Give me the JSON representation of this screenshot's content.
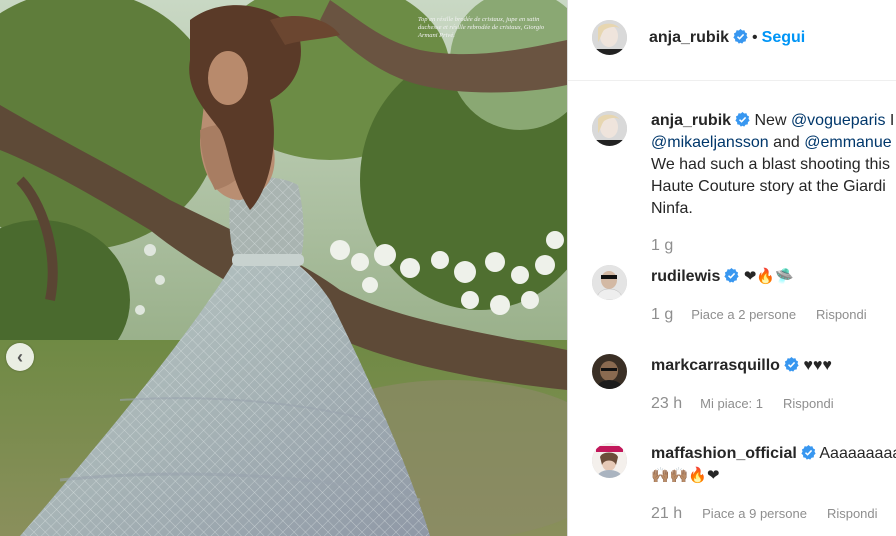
{
  "photo": {
    "caption": "Top en résille brodée de cristaux, jupe en satin duchesse et résille rebrodée de cristaux, Giorgio Armani Privé.",
    "nav_prev_glyph": "‹"
  },
  "header": {
    "username": "anja_rubik",
    "separator": "•",
    "follow_label": "Segui"
  },
  "post_caption": {
    "username": "anja_rubik",
    "line1_pre": "New ",
    "line1_mention": "@vogueparis",
    "line1_post": " I",
    "line2_mention_a": "@mikaeljansson",
    "line2_mid": " and ",
    "line2_mention_b": "@emmanue",
    "line3": "We had such a blast shooting this",
    "line4": "Haute Couture story at the Giardi",
    "line5": "Ninfa.",
    "time": "1 g"
  },
  "comments": [
    {
      "username": "rudilewis",
      "text": "❤🔥🛸",
      "time": "1 g",
      "likes": "Piace a 2 persone",
      "reply": "Rispondi"
    },
    {
      "username": "markcarrasquillo",
      "text": "♥♥♥",
      "time": "23 h",
      "likes": "Mi piace: 1",
      "reply": "Rispondi"
    },
    {
      "username": "maffashion_official",
      "text": "Aaaaaaaaa",
      "text_line2": "🙌🏽🙌🏽🔥❤",
      "time": "21 h",
      "likes": "Piace a 9 persone",
      "reply": "Rispondi"
    }
  ],
  "colors": {
    "follow_blue": "#0095f6",
    "verified_blue": "#3897f0",
    "text_primary": "#262626",
    "text_secondary": "#8e8e8e"
  },
  "icons": [
    "verified-badge-icon",
    "chevron-left-icon"
  ]
}
